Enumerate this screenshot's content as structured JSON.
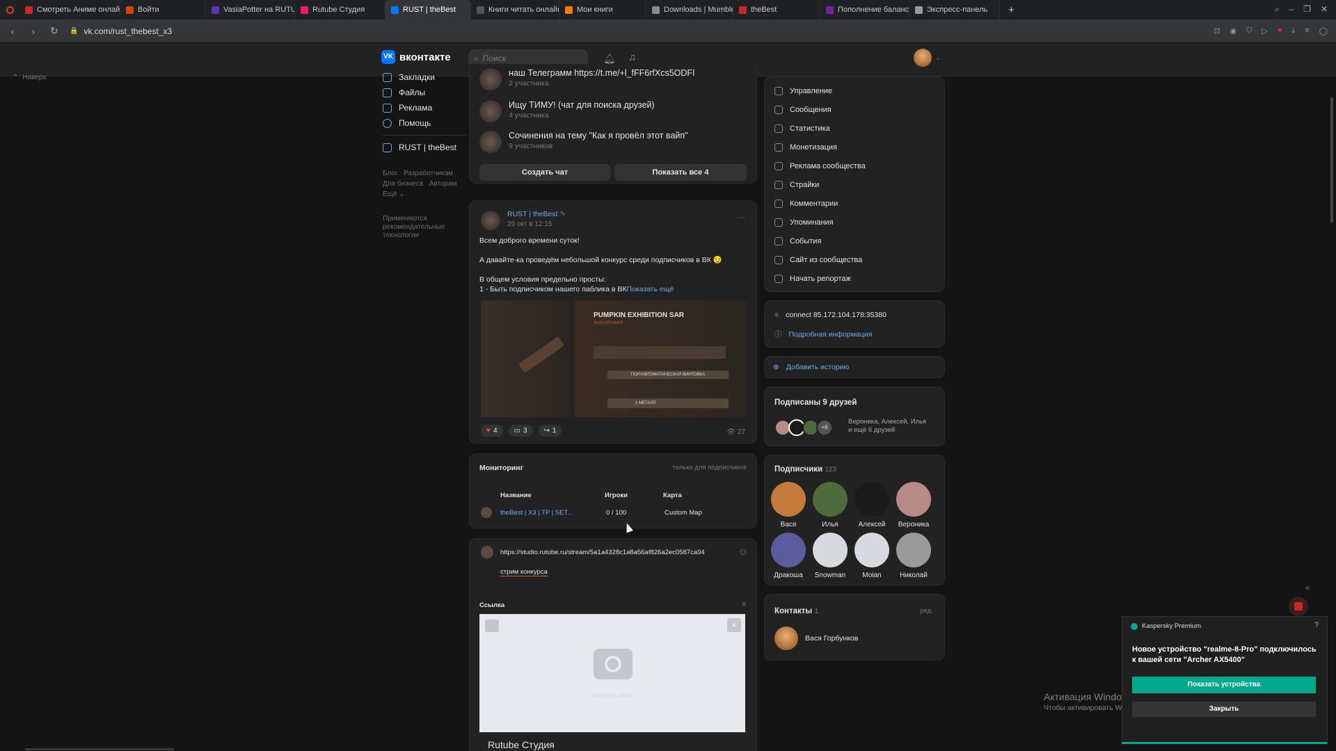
{
  "browser": {
    "tabs": [
      {
        "label": "Смотреть Аниме онлайн",
        "color": "#c62828"
      },
      {
        "label": "Войти",
        "color": "#d84315"
      },
      {
        "label": "VasiaPotter на RUTUBE: З",
        "color": "#5e35b1"
      },
      {
        "label": "Rutube Студия",
        "color": "#e91e63"
      },
      {
        "label": "RUST | theBest",
        "color": "#0077ff",
        "active": true
      },
      {
        "label": "Книги читать онлайн бе",
        "color": "#555555"
      },
      {
        "label": "Мои книги",
        "color": "#f57c00"
      },
      {
        "label": "Downloads | Mumble",
        "color": "#888888"
      },
      {
        "label": "theBest",
        "color": "#c62828"
      },
      {
        "label": "Пополнение баланса Sti",
        "color": "#7b1fa2"
      },
      {
        "label": "Экспресс-панель",
        "color": "#999999"
      }
    ],
    "url": "vk.com/rust_thebest_x3",
    "new_tab": "+"
  },
  "header": {
    "logo_text": "вконтакте",
    "logo_mark": "VK",
    "search_placeholder": "Поиск"
  },
  "back_link": "Наверх",
  "left_menu": {
    "items": [
      "Закладки",
      "Файлы",
      "Реклама",
      "Помощь"
    ],
    "group": "RUST | theBest",
    "links_row1": [
      "Блог",
      "Разработчикам"
    ],
    "links_row2": [
      "Для бизнеса",
      "Авторам"
    ],
    "more": "Ещё ⌄",
    "recommend_line1": "Применяются",
    "recommend_line2": "рекомендательные",
    "recommend_line3": "технологии"
  },
  "chats": [
    {
      "title": "наш Телеграмм https://t.me/+l_fFF6rfXcs5ODFI",
      "sub": "2 участника"
    },
    {
      "title": "Ищу ТИМУ! (чат для поиска друзей)",
      "sub": "4 участника"
    },
    {
      "title": "Сочинения на тему \"Как я провёл этот вайп\"",
      "sub": "9 участников"
    }
  ],
  "chat_buttons": {
    "create": "Создать чат",
    "show_all": "Показать все 4"
  },
  "post": {
    "author": "RUST | theBest",
    "date": "29 окт в 12:15",
    "more": "···",
    "line1": "Всем доброго времени суток!",
    "line2": "А давайте-ка проведём небольшой конкурс среди подписчиков в ВК 😏",
    "line3": "В общем условия предельно просты:",
    "line4": "1 - Быть подписчиком нашего паблика в ВК",
    "show_more": "Показать ещё",
    "image_title": "PUMPKIN EXHIBITION SAR",
    "image_sub": "SKIN ОРУЖИЯ",
    "image_weapon": "ПОЛУАВТОМАТИЧЕСКАЯ ВИНТОВКА",
    "image_metal": "1 МЕТАЛЛ",
    "likes": "4",
    "comments": "3",
    "shares": "1",
    "views": "27"
  },
  "monitoring": {
    "title": "Мониторинг",
    "note": "только для подписчиков",
    "headers": [
      "Название",
      "Игроки",
      "Карта"
    ],
    "row": {
      "name": "theBest | X3 | TP | SET...",
      "players": "0 / 100",
      "map": "Custom Map"
    }
  },
  "composer": {
    "text_url": "https://studio.rutube.ru/stream/5a1a4328c1a8a56af826a2ec0587ca94",
    "text_body": "стрим конкурса",
    "link_label": "Ссылка",
    "close": "×",
    "preview_title": "Rutube Студия",
    "camera_hint": "Загрузить фото"
  },
  "right_menu": {
    "items": [
      "Управление",
      "Сообщения",
      "Статистика",
      "Монетизация",
      "Реклама сообщества",
      "Страйки",
      "Комментарии",
      "Упоминания",
      "События",
      "Сайт из сообщества",
      "Начать репортаж"
    ]
  },
  "info": {
    "connect": "connect 85.172.104.178:35380",
    "details": "Подробная информация",
    "add_story": "Добавить историю"
  },
  "friends": {
    "title": "Подписаны 9 друзей",
    "more_badge": "+6",
    "names": "Вероника, Алексей, Илья",
    "names2": "и ещё 6 друзей"
  },
  "subscribers": {
    "title": "Подписчики",
    "count": "123",
    "people": [
      {
        "name": "Вася",
        "color": "#c47a3a"
      },
      {
        "name": "Илья",
        "color": "#4d6b3c"
      },
      {
        "name": "Алексей",
        "color": "#1b1b1b"
      },
      {
        "name": "Вероника",
        "color": "#b78a86"
      },
      {
        "name": "Дракоша",
        "color": "#5a5c9e"
      },
      {
        "name": "Snowman",
        "color": "#d6d9dd"
      },
      {
        "name": "Moian",
        "color": "#d6d9dd"
      },
      {
        "name": "Николай",
        "color": "#9a9a9a"
      }
    ]
  },
  "contacts": {
    "title": "Контакты",
    "count": "1",
    "edit": "ред.",
    "person": "Вася Горбунков"
  },
  "notification": {
    "app": "Kaspersky Premium",
    "help": "?",
    "message": "Новое устройство \"realme-8-Pro\" подключилось к вашей сети \"Archer AX5400\"",
    "primary": "Показать устройства",
    "secondary": "Закрыть"
  },
  "watermark": {
    "title": "Активация Windows",
    "text": "Чтобы активировать Windows, перейдите в раздел \"Параметры\"."
  }
}
